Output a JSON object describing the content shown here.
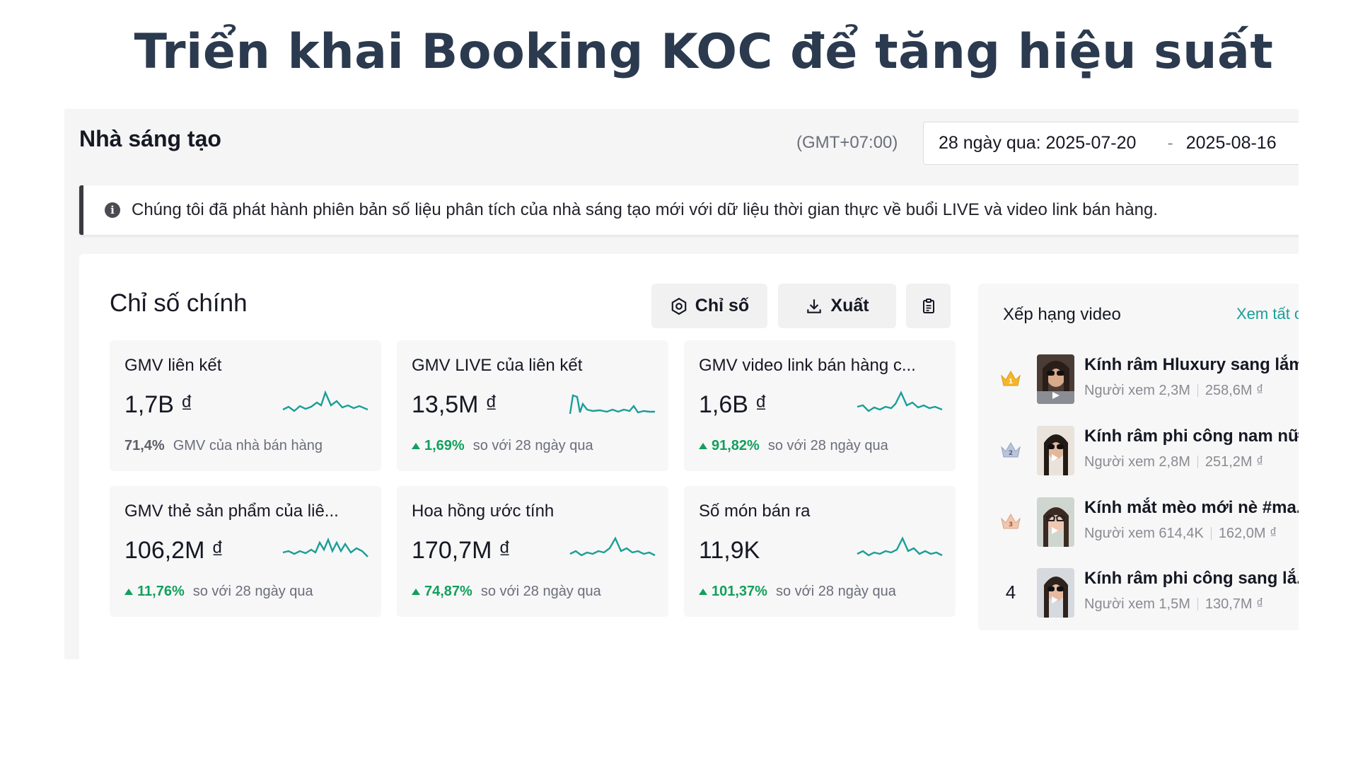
{
  "headline": "Triển khai Booking KOC để tăng hiệu suất",
  "header": {
    "title": "Nhà sáng tạo",
    "timezone": "(GMT+07:00)",
    "date_range": {
      "label": "28 ngày qua: 2025-07-20",
      "separator": "-",
      "end": "2025-08-16"
    }
  },
  "notice": {
    "icon": "info-icon",
    "text": "Chúng tôi đã phát hành phiên bản số liệu phân tích của nhà sáng tạo mới với dữ liệu thời gian thực về buổi LIVE và video link bán hàng."
  },
  "metrics": {
    "title": "Chỉ số chính",
    "buttons": {
      "metrics": "Chỉ số",
      "export": "Xuất"
    },
    "cards": [
      {
        "label": "GMV liên kết",
        "value": "1,7B ₫",
        "pct": "71,4%",
        "note": "GMV của nhà bán hàng",
        "trend": "neutral"
      },
      {
        "label": "GMV LIVE của liên kết",
        "value": "13,5M ₫",
        "pct": "1,69%",
        "note": "so với 28 ngày qua",
        "trend": "up"
      },
      {
        "label": "GMV video link bán hàng c...",
        "value": "1,6B ₫",
        "pct": "91,82%",
        "note": "so với 28 ngày qua",
        "trend": "up"
      },
      {
        "label": "GMV thẻ sản phẩm của liê...",
        "value": "106,2M ₫",
        "pct": "11,76%",
        "note": "so với 28 ngày qua",
        "trend": "up"
      },
      {
        "label": "Hoa hồng ước tính",
        "value": "170,7M ₫",
        "pct": "74,87%",
        "note": "so với 28 ngày qua",
        "trend": "up"
      },
      {
        "label": "Số món bán ra",
        "value": "11,9K",
        "pct": "101,37%",
        "note": "so với 28 ngày qua",
        "trend": "up"
      }
    ],
    "colors": {
      "up": "#12a05c",
      "sparkline": "#1a9e97"
    }
  },
  "ranking": {
    "title": "Xếp hạng video",
    "see_all": "Xem tất cả",
    "items": [
      {
        "rank": "1",
        "badge": "crown-gold-icon",
        "name": "Kính râm Hluxury sang lắm...",
        "views": "Người xem 2,3M",
        "gmv": "258,6M ₫"
      },
      {
        "rank": "2",
        "badge": "crown-silver-icon",
        "name": "Kính râm phi công nam nữ ...",
        "views": "Người xem 2,8M",
        "gmv": "251,2M ₫"
      },
      {
        "rank": "3",
        "badge": "crown-bronze-icon",
        "name": "Kính mắt mèo mới nè #ma...",
        "views": "Người xem 614,4K",
        "gmv": "162,0M ₫"
      },
      {
        "rank": "4",
        "badge": "",
        "name": "Kính râm phi công sang lắ...",
        "views": "Người xem 1,5M",
        "gmv": "130,7M ₫"
      }
    ]
  }
}
